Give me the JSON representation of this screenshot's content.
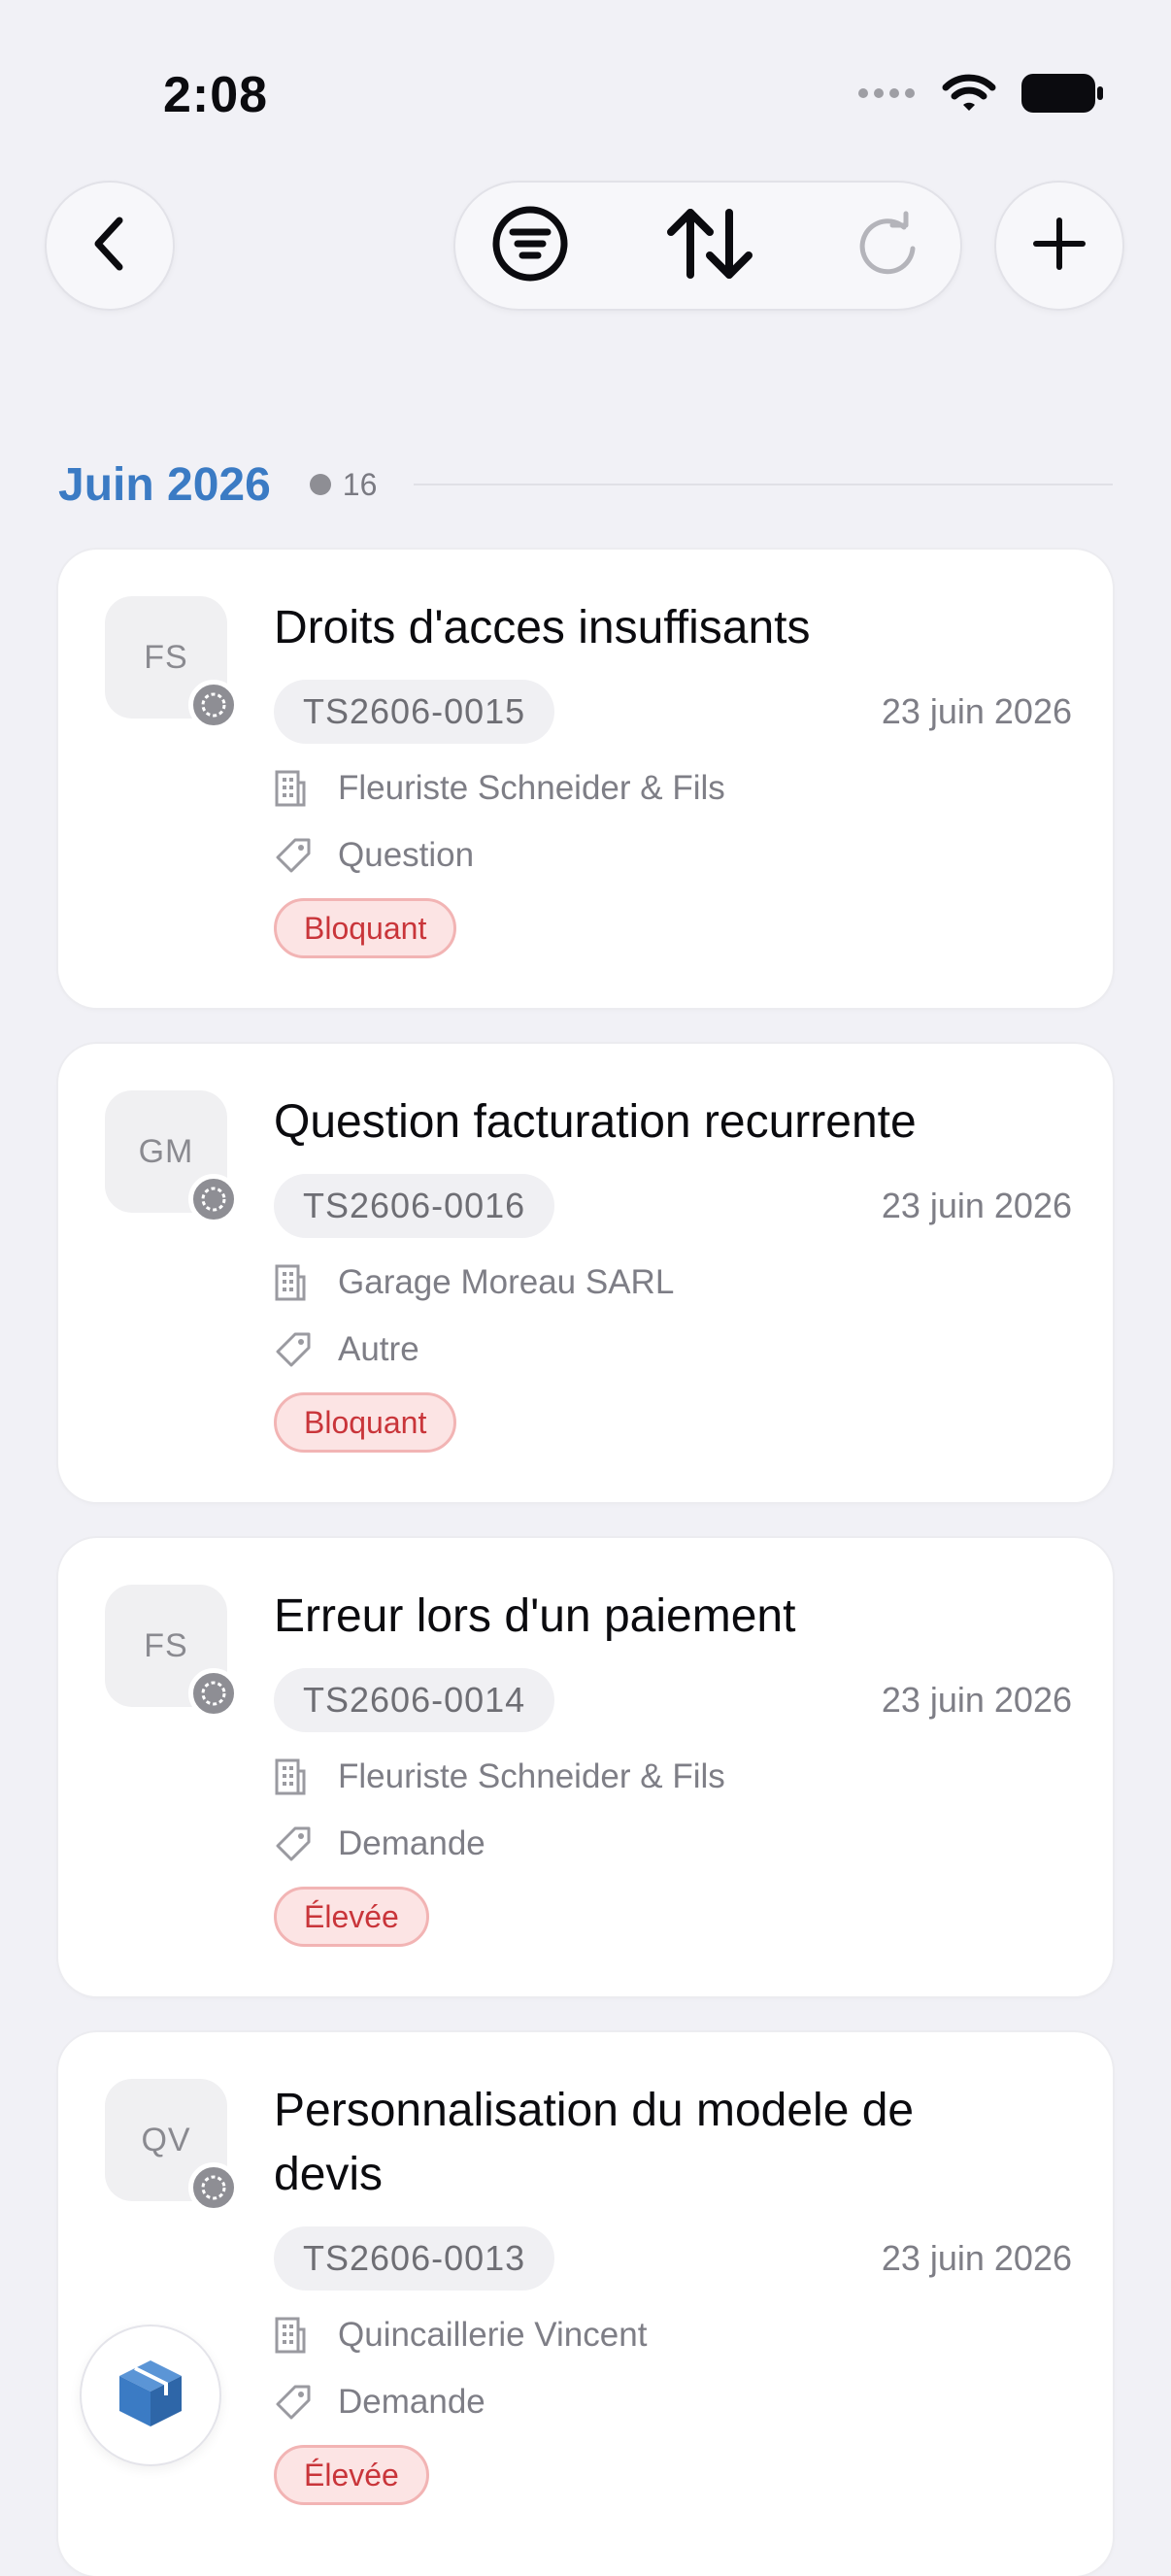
{
  "status_bar": {
    "time": "2:08"
  },
  "toolbar": {
    "back_icon": "chevron-left-icon",
    "filter_icon": "filter-icon",
    "sort_icon": "sort-arrows-icon",
    "refresh_icon": "refresh-icon",
    "add_icon": "plus-icon"
  },
  "section": {
    "title": "Juin 2026",
    "count": "16"
  },
  "tickets": [
    {
      "initials": "FS",
      "title": "Droits d'acces insuffisants",
      "reference": "TS2606-0015",
      "date": "23 juin 2026",
      "company": "Fleuriste Schneider & Fils",
      "type": "Question",
      "priority": "Bloquant"
    },
    {
      "initials": "GM",
      "title": "Question facturation recurrente",
      "reference": "TS2606-0016",
      "date": "23 juin 2026",
      "company": "Garage Moreau SARL",
      "type": "Autre",
      "priority": "Bloquant"
    },
    {
      "initials": "FS",
      "title": "Erreur lors d'un paiement",
      "reference": "TS2606-0014",
      "date": "23 juin 2026",
      "company": "Fleuriste Schneider & Fils",
      "type": "Demande",
      "priority": "Élevée"
    },
    {
      "initials": "QV",
      "title": "Personnalisation du modele de devis",
      "reference": "TS2606-0013",
      "date": "23 juin 2026",
      "company": "Quincaillerie Vincent",
      "type": "Demande",
      "priority": "Élevée"
    }
  ],
  "floating_button": {
    "icon": "box-icon"
  },
  "colors": {
    "accent": "#3B7BC4",
    "priority_text": "#C9353A",
    "priority_bg": "#FCE4E4",
    "background": "#F1F1F6"
  }
}
